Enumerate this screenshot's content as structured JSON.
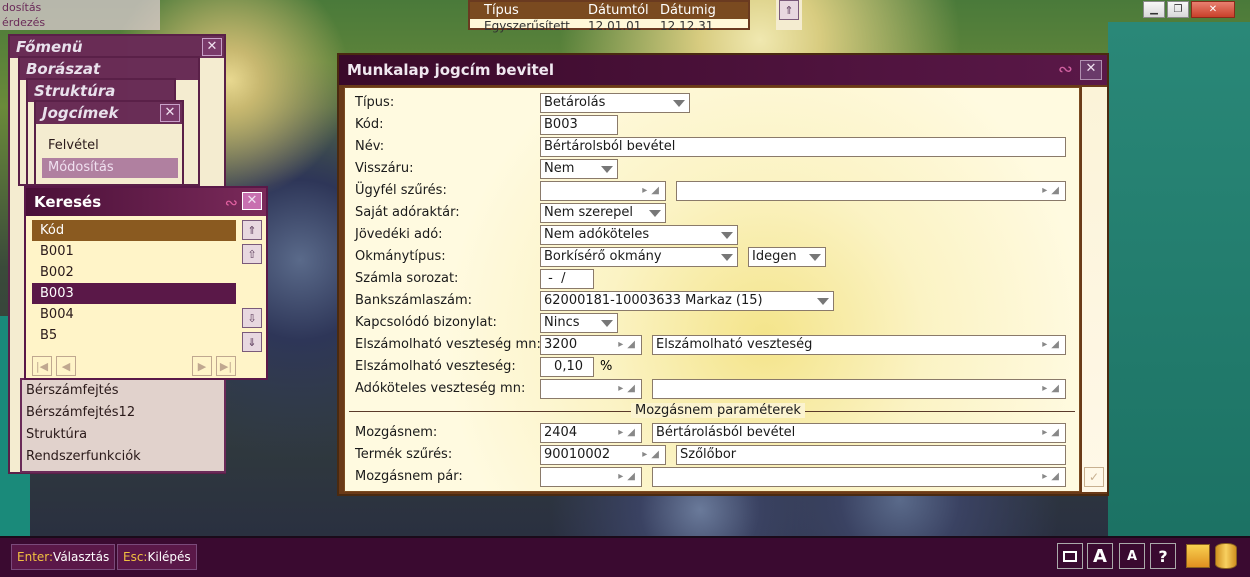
{
  "top_strip": {
    "items": [
      "dosítás",
      "érdezés"
    ]
  },
  "menu": {
    "fomenu_title": "Főmenü",
    "boraszat_title": "Borászat",
    "struktura_title": "Struktúra",
    "jogcimek_title": "Jogcímek",
    "jogcimek_items": [
      "Felvétel",
      "Módosítás"
    ],
    "left_items": [
      "Bérszámfejtés",
      "Bérszámfejtés12",
      "Struktúra",
      "Rendszerfunkciók"
    ]
  },
  "top_table": {
    "headers": [
      "Típus",
      "Dátumtól",
      "Dátumig"
    ],
    "row": [
      "Egyszerűsített",
      "12.01.01",
      "12.12.31"
    ]
  },
  "search": {
    "title": "Keresés",
    "header": "Kód",
    "items": [
      "B001",
      "B002",
      "B003",
      "B004",
      "B5"
    ],
    "selected": "B003"
  },
  "main": {
    "title": "Munkalap jogcím bevitel",
    "labels": {
      "tipus": "Típus:",
      "kod": "Kód:",
      "nev": "Név:",
      "visszaru": "Visszáru:",
      "ugyfel": "Ügyfél szűrés:",
      "sajat": "Saját adóraktár:",
      "jovedeki": "Jövedéki adó:",
      "okmany": "Okmánytípus:",
      "szamla": "Számla sorozat:",
      "bank": "Bankszámlaszám:",
      "kapcs": "Kapcsolódó bizonylat:",
      "elsz_mn": "Elszámolható veszteség mn:",
      "elsz": "Elszámolható veszteség:",
      "adokot": "Adóköteles veszteség mn:",
      "mozgasnem": "Mozgásnem:",
      "termek": "Termék szűrés:",
      "mozgas_par": "Mozgásnem pár:"
    },
    "values": {
      "tipus": "Betárolás",
      "kod": "B003",
      "nev": "Bértárolsból bevétel",
      "visszaru": "Nem",
      "ugyfel": "",
      "ugyfel_name": "",
      "sajat": "Nem szerepel",
      "jovedeki": "Nem adóköteles",
      "okmany": "Borkísérő okmány",
      "okmany2": "Idegen",
      "szamla": " -  /",
      "bank": "62000181-10003633 Markaz (15)",
      "kapcs": "Nincs",
      "elsz_mn_code": "3200",
      "elsz_mn_name": "Elszámolható veszteség",
      "elsz": "0,10",
      "elsz_unit": "%",
      "adokot_code": "",
      "adokot_name": "",
      "mozgasnem_code": "2404",
      "mozgasnem_name": "Bértárolásból bevétel",
      "termek_code": "90010002",
      "termek_name": "Szőlőbor",
      "mozgas_par_code": "",
      "mozgas_par_name": ""
    },
    "section_label": "Mozgásnem paraméterek"
  },
  "bottom": {
    "enter_key": "Enter:",
    "enter_label": "Választás",
    "esc_key": "Esc:",
    "esc_label": "Kilépés"
  }
}
